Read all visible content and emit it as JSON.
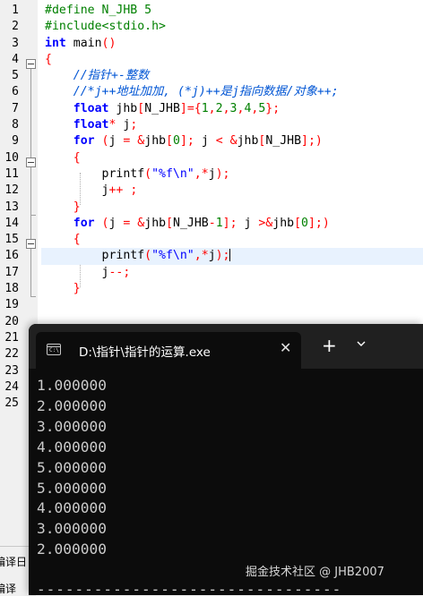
{
  "editor": {
    "lines": [
      {
        "n": "1",
        "parts": [
          [
            "pp",
            "#define N_JHB 5"
          ]
        ]
      },
      {
        "n": "2",
        "parts": [
          [
            "pp",
            "#include<stdio.h>"
          ]
        ]
      },
      {
        "n": "3",
        "parts": [
          [
            "kw",
            "int"
          ],
          [
            "",
            " main"
          ],
          [
            "op",
            "()"
          ]
        ]
      },
      {
        "n": "4",
        "parts": [
          [
            "op",
            "{"
          ]
        ]
      },
      {
        "n": "5",
        "parts": [
          [
            "",
            "    "
          ],
          [
            "cm",
            "//指针+-整数"
          ]
        ]
      },
      {
        "n": "6",
        "parts": [
          [
            "",
            "    "
          ],
          [
            "cm",
            "//*j++地址加加, (*j)++是j指向数据/对象++;"
          ]
        ]
      },
      {
        "n": "7",
        "parts": [
          [
            "",
            "    "
          ],
          [
            "kw",
            "float"
          ],
          [
            "",
            " jhb"
          ],
          [
            "op",
            "["
          ],
          [
            "",
            "N_JHB"
          ],
          [
            "op",
            "]={"
          ],
          [
            "num",
            "1"
          ],
          [
            "op",
            ","
          ],
          [
            "num",
            "2"
          ],
          [
            "op",
            ","
          ],
          [
            "num",
            "3"
          ],
          [
            "op",
            ","
          ],
          [
            "num",
            "4"
          ],
          [
            "op",
            ","
          ],
          [
            "num",
            "5"
          ],
          [
            "op",
            "};"
          ]
        ]
      },
      {
        "n": "8",
        "parts": [
          [
            "",
            "    "
          ],
          [
            "kw",
            "float"
          ],
          [
            "op",
            "*"
          ],
          [
            "",
            " j"
          ],
          [
            "op",
            ";"
          ]
        ]
      },
      {
        "n": "9",
        "parts": [
          [
            "",
            "    "
          ],
          [
            "kw",
            "for"
          ],
          [
            "",
            " "
          ],
          [
            "op",
            "("
          ],
          [
            "",
            "j "
          ],
          [
            "op",
            "="
          ],
          [
            "",
            " "
          ],
          [
            "op",
            "&"
          ],
          [
            "",
            "jhb"
          ],
          [
            "op",
            "["
          ],
          [
            "num",
            "0"
          ],
          [
            "op",
            "];"
          ],
          [
            "",
            " j "
          ],
          [
            "op",
            "<"
          ],
          [
            "",
            " "
          ],
          [
            "op",
            "&"
          ],
          [
            "",
            "jhb"
          ],
          [
            "op",
            "["
          ],
          [
            "",
            "N_JHB"
          ],
          [
            "op",
            "];)"
          ]
        ]
      },
      {
        "n": "10",
        "parts": [
          [
            "",
            "    "
          ],
          [
            "op",
            "{"
          ]
        ]
      },
      {
        "n": "11",
        "parts": [
          [
            "",
            "        printf"
          ],
          [
            "op",
            "("
          ],
          [
            "str",
            "\"%f\\n\""
          ],
          [
            "op",
            ",*"
          ],
          [
            "",
            "j"
          ],
          [
            "op",
            ");"
          ]
        ]
      },
      {
        "n": "12",
        "parts": [
          [
            "",
            "        j"
          ],
          [
            "op",
            "++"
          ],
          [
            "",
            " "
          ],
          [
            "op",
            ";"
          ]
        ]
      },
      {
        "n": "13",
        "parts": [
          [
            "",
            "    "
          ],
          [
            "op",
            "}"
          ]
        ]
      },
      {
        "n": "14",
        "parts": [
          [
            "",
            "    "
          ],
          [
            "kw",
            "for"
          ],
          [
            "",
            " "
          ],
          [
            "op",
            "("
          ],
          [
            "",
            "j "
          ],
          [
            "op",
            "="
          ],
          [
            "",
            " "
          ],
          [
            "op",
            "&"
          ],
          [
            "",
            "jhb"
          ],
          [
            "op",
            "["
          ],
          [
            "",
            "N_JHB"
          ],
          [
            "op",
            "-"
          ],
          [
            "num",
            "1"
          ],
          [
            "op",
            "];"
          ],
          [
            "",
            " j "
          ],
          [
            "op",
            ">&"
          ],
          [
            "",
            "jhb"
          ],
          [
            "op",
            "["
          ],
          [
            "num",
            "0"
          ],
          [
            "op",
            "];)"
          ]
        ]
      },
      {
        "n": "15",
        "parts": [
          [
            "",
            "    "
          ],
          [
            "op",
            "{"
          ]
        ]
      },
      {
        "n": "16",
        "parts": [
          [
            "",
            "        printf"
          ],
          [
            "op",
            "("
          ],
          [
            "str",
            "\"%f\\n\""
          ],
          [
            "op",
            ",*"
          ],
          [
            "",
            "j"
          ],
          [
            "op",
            ");"
          ]
        ]
      },
      {
        "n": "17",
        "parts": [
          [
            "",
            "        j"
          ],
          [
            "op",
            "--"
          ],
          [
            "op",
            ";"
          ]
        ]
      },
      {
        "n": "18",
        "parts": [
          [
            "",
            "    "
          ],
          [
            "op",
            "}"
          ]
        ]
      },
      {
        "n": "19",
        "parts": []
      },
      {
        "n": "20",
        "parts": []
      },
      {
        "n": "21",
        "parts": []
      },
      {
        "n": "22",
        "parts": []
      },
      {
        "n": "23",
        "parts": []
      },
      {
        "n": "24",
        "parts": []
      },
      {
        "n": "25",
        "parts": []
      }
    ],
    "highlighted_line": "16",
    "bottom_panel_labels": [
      "编译日",
      "编译"
    ]
  },
  "terminal": {
    "tab_title": "D:\\指针\\指针的运算.exe",
    "tab_icon_text": "C:\\",
    "close_glyph": "✕",
    "new_tab_glyph": "+",
    "output_lines": [
      "1.000000",
      "2.000000",
      "3.000000",
      "4.000000",
      "5.000000",
      "5.000000",
      "4.000000",
      "3.000000",
      "2.000000"
    ],
    "trailing_dashes": "--------------------------------",
    "watermark": "掘金技术社区 @ JHB2007"
  },
  "colors": {
    "preprocessor": "#008000",
    "keyword": "#0000ff",
    "operator": "#ff0000",
    "string": "#0000ff",
    "number": "#008000",
    "comment": "#0055d4",
    "terminal_bg": "#0c0c0c",
    "terminal_text": "#cccccc"
  }
}
